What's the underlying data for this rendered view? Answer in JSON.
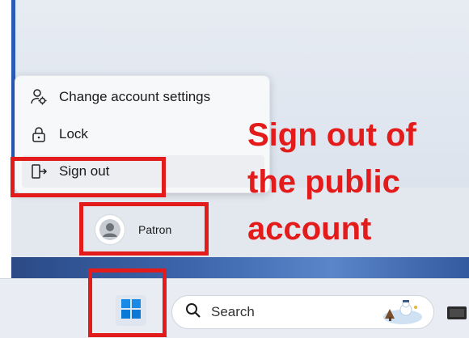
{
  "context_menu": {
    "items": [
      {
        "label": "Change account settings",
        "icon": "account-settings-icon"
      },
      {
        "label": "Lock",
        "icon": "lock-icon"
      },
      {
        "label": "Sign out",
        "icon": "sign-out-icon"
      }
    ]
  },
  "user": {
    "name": "Patron",
    "icon": "user-avatar-icon"
  },
  "taskbar": {
    "start_icon": "windows-logo-icon",
    "search_label": "Search",
    "search_icon": "search-icon"
  },
  "annotation": {
    "lines": [
      "Sign out of",
      "the public",
      "account"
    ],
    "color": "#e31b1b"
  },
  "colors": {
    "windows_blue": "#0a78d7",
    "annotation_red": "#e31b1b"
  }
}
